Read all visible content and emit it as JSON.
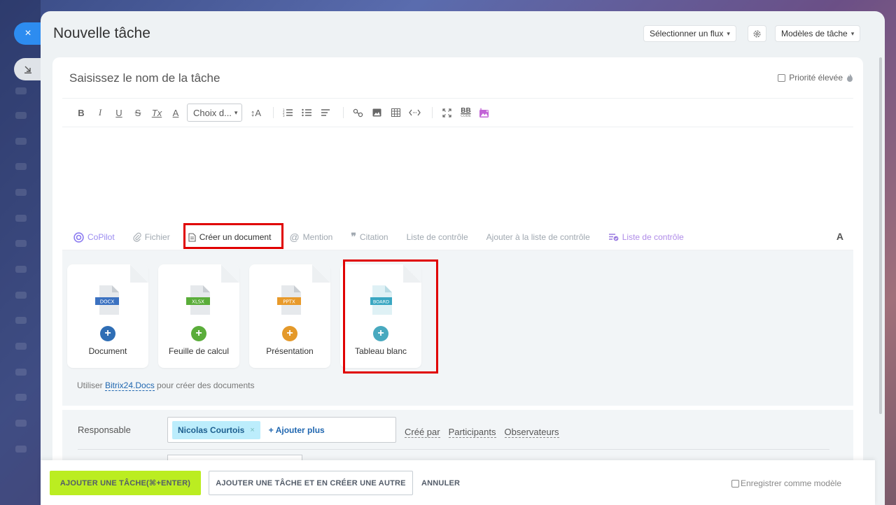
{
  "header": {
    "title": "Nouvelle tâche",
    "select_flow": "Sélectionner un flux",
    "templates": "Modèles de tâche"
  },
  "task": {
    "name_placeholder": "Saisissez le nom de la tâche",
    "priority_label": "Priorité élevée"
  },
  "toolbar": {
    "bold": "B",
    "italic": "I",
    "underline": "U",
    "strike": "S",
    "clear": "Tx",
    "color": "A",
    "font_select": "Choix d...",
    "font_size": "↕A",
    "bbcode_top": "BB",
    "bbcode_bottom": "CODE"
  },
  "tabs": {
    "copilot": "CoPilot",
    "file": "Fichier",
    "create_doc": "Créer un document",
    "mention": "Mention",
    "quote": "Citation",
    "checklist": "Liste de contrôle",
    "add_checklist": "Ajouter à la liste de contrôle",
    "checklist2": "Liste de contrôle",
    "text_format": "A"
  },
  "documents": [
    {
      "badge": "DOCX",
      "label": "Document",
      "badge_color": "#3c72c1",
      "plus_color": "#2f6eb5"
    },
    {
      "badge": "XLSX",
      "label": "Feuille de calcul",
      "badge_color": "#5aad3a",
      "plus_color": "#5aad3a"
    },
    {
      "badge": "PPTX",
      "label": "Présentation",
      "badge_color": "#e89a2b",
      "plus_color": "#e4992a"
    },
    {
      "badge": "BOARD",
      "label": "Tableau blanc",
      "badge_color": "#3aa7c2",
      "plus_color": "#48a9bf"
    }
  ],
  "docs_note": {
    "prefix": "Utiliser",
    "link": "Bitrix24.Docs",
    "suffix": "pour créer des documents"
  },
  "responsible": {
    "label": "Responsable",
    "person": "Nicolas Courtois",
    "remove": "×",
    "add_more": "+ Ajouter plus",
    "links": [
      "Créé par",
      "Participants",
      "Observateurs"
    ]
  },
  "footer": {
    "add_task": "AJOUTER UNE TÂCHE(⌘+ENTER)",
    "add_and_new": "AJOUTER UNE TÂCHE ET EN CRÉER UNE AUTRE",
    "cancel": "ANNULER",
    "save_template": "Enregistrer comme modèle"
  },
  "window": {
    "close": "×"
  },
  "colors": {
    "highlight": "#e00000",
    "primary_button": "#bbed21",
    "close_button": "#2d8cf0"
  }
}
